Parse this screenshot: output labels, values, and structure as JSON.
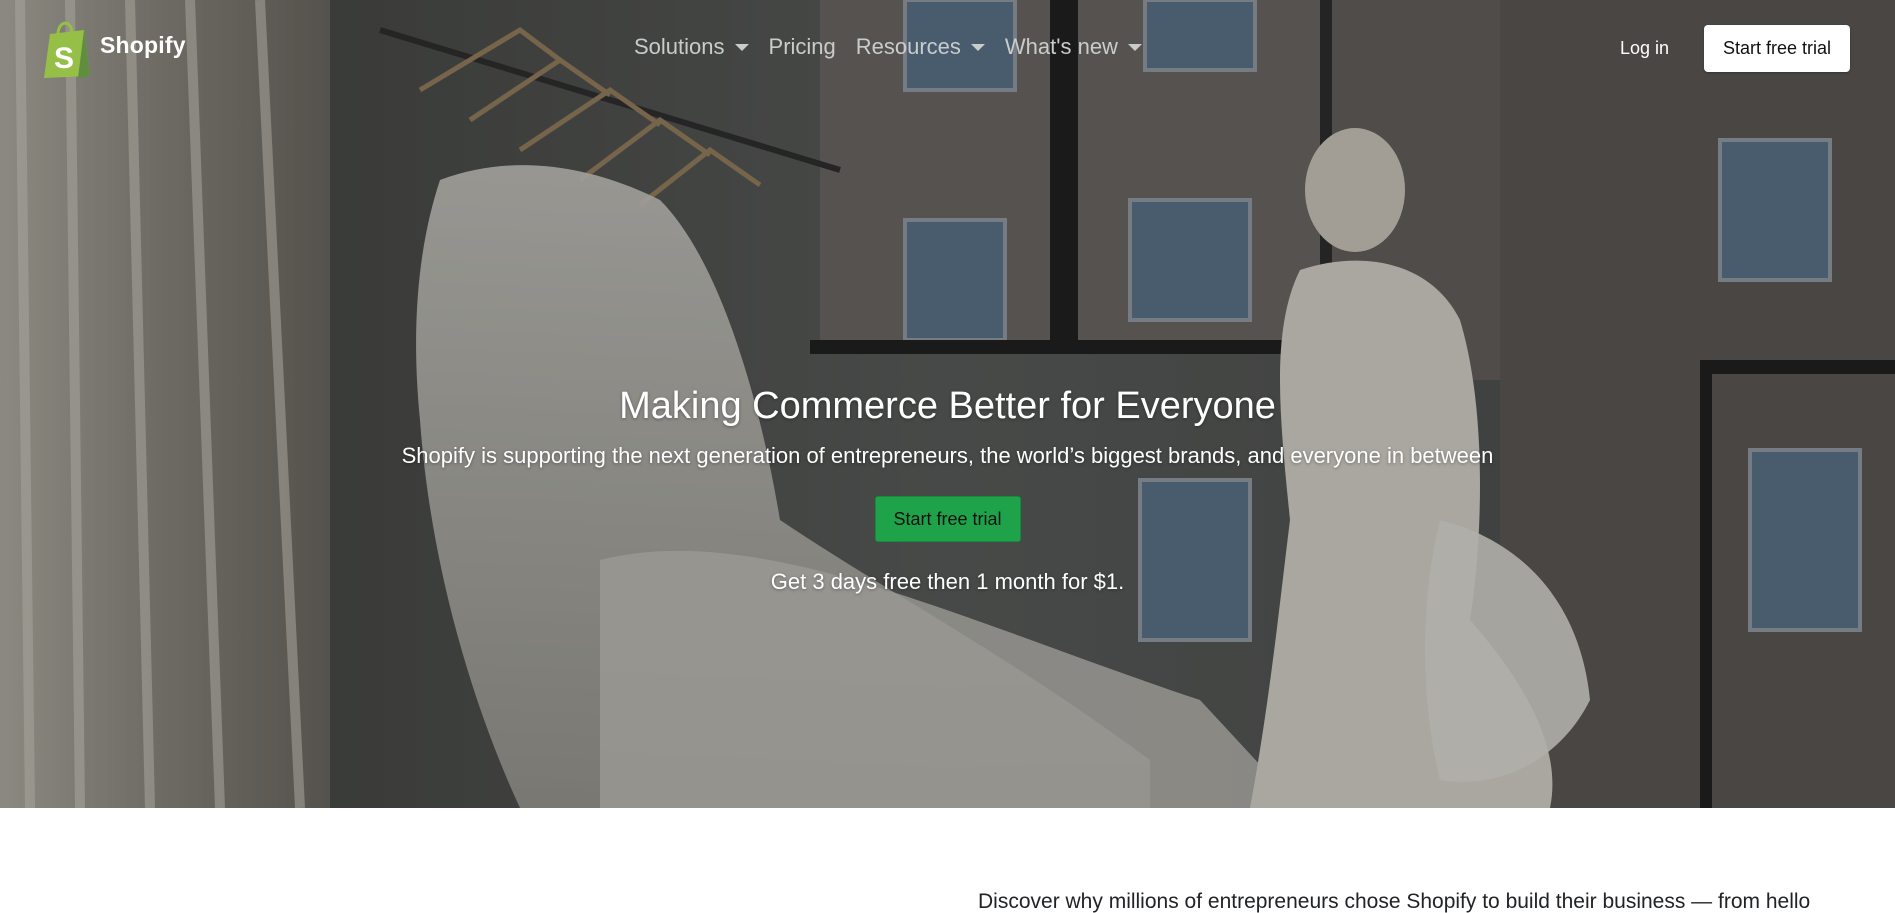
{
  "brand": {
    "name": "Shopify",
    "logo_letter": "S",
    "logo_color": "#95bf47",
    "logo_dark": "#5e8e3e"
  },
  "nav": {
    "menu": [
      {
        "label": "Solutions",
        "has_dropdown": true
      },
      {
        "label": "Pricing",
        "has_dropdown": false
      },
      {
        "label": "Resources",
        "has_dropdown": true
      },
      {
        "label": "What's new",
        "has_dropdown": true
      }
    ],
    "login_label": "Log in",
    "trial_label": "Start free trial"
  },
  "hero": {
    "title": "Making Commerce Better for Everyone",
    "subtitle": "Shopify is supporting the next generation of entrepreneurs, the world’s biggest brands, and everyone in between",
    "cta_label": "Start free trial",
    "cta_color": "#1fa34a",
    "offer": "Get 3 days free then 1 month for $1."
  },
  "intro": {
    "text": "Discover why millions of entrepreneurs chose Shopify to build their business — from hello"
  }
}
